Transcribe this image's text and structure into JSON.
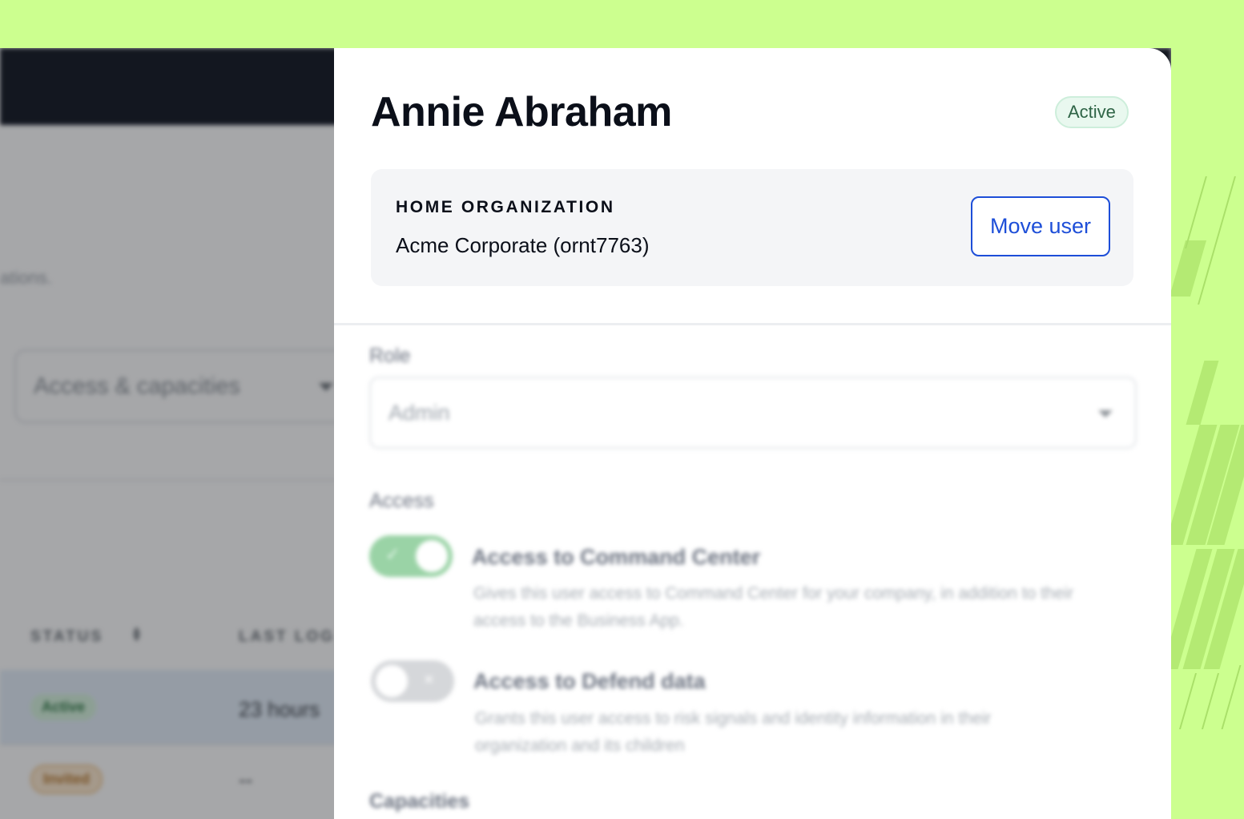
{
  "background_app": {
    "intro_fragment": "ations.",
    "filter_select": {
      "value": "Access & capacities"
    },
    "table": {
      "headers": [
        "STATUS",
        "LAST LOG"
      ],
      "rows": [
        {
          "status": "Active",
          "last_login": "23 hours"
        },
        {
          "status": "Invited",
          "last_login": "--"
        }
      ]
    }
  },
  "drawer": {
    "user_name": "Annie Abraham",
    "status": "Active",
    "home_org": {
      "label": "HOME ORGANIZATION",
      "value": "Acme Corporate (ornt7763)",
      "move_button": "Move user"
    },
    "role": {
      "label": "Role",
      "value": "Admin"
    },
    "access": {
      "label": "Access",
      "options": [
        {
          "title": "Access to Command Center",
          "description": "Gives this user access to Command Center for your company, in addition to their access to the Business App.",
          "enabled": true
        },
        {
          "title": "Access to Defend data",
          "description": "Grants this user access to risk signals and identity information in their organization and its children",
          "enabled": false
        }
      ]
    },
    "capacities": {
      "label": "Capacities"
    }
  },
  "colors": {
    "backdrop": "#ccff8f",
    "accent_blue": "#1d4ed8",
    "active_badge_bg": "#e9f8ef",
    "app_header": "#121722"
  }
}
